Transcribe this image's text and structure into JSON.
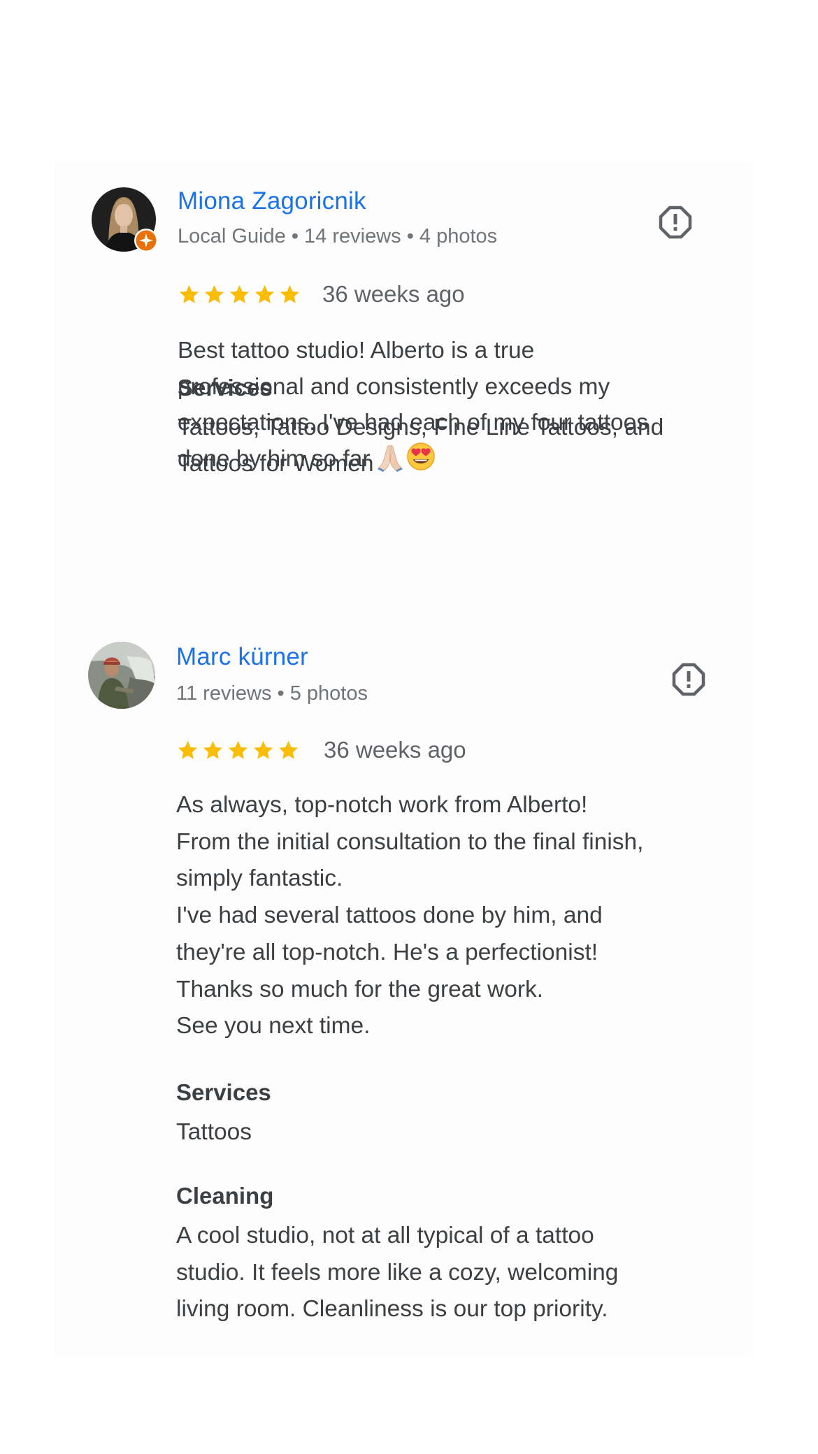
{
  "reviews": [
    {
      "author": "Miona Zagoricnik",
      "meta": "Local Guide • 14 reviews • 4 photos",
      "local_guide": true,
      "rating": 5,
      "time": "36 weeks ago",
      "text_lines": [
        "Best tattoo studio! Alberto is a true",
        "professional and consistently exceeds my",
        "expectations. I've had each of my four tattoos",
        "done by him so far"
      ],
      "text_emoji": [
        "folded-hands-emoji",
        "heart-eyes-emoji"
      ],
      "sections": [
        {
          "title": "Services",
          "lines": [
            "Tattoos, Tattoo Designs, Fine Line Tattoos, and",
            "Tattoos for Women"
          ]
        }
      ]
    },
    {
      "author": "Marc kürner",
      "meta": "11 reviews • 5 photos",
      "local_guide": false,
      "rating": 5,
      "time": "36 weeks ago",
      "text_lines": [
        "As always, top-notch work from Alberto!",
        "From the initial consultation to the final finish,",
        "simply fantastic.",
        "I've had several tattoos done by him, and",
        "they're all top-notch. He's a perfectionist!",
        "Thanks so much for the great work.",
        "See you next time."
      ],
      "sections": [
        {
          "title": "Services",
          "lines": [
            "Tattoos"
          ]
        },
        {
          "title": "Cleaning",
          "lines": [
            "A cool studio, not at all typical of a tattoo",
            "studio. It feels more like a cozy, welcoming",
            "living room. Cleanliness is our top priority."
          ]
        }
      ]
    }
  ],
  "colors": {
    "name": "#1a73e8",
    "star": "#fbbc04",
    "meta": "#70757a",
    "text": "#3c4043",
    "guide_badge": "#e8710a"
  },
  "icons": {
    "report": "report-flag-icon",
    "star": "star-icon",
    "local_guide": "local-guide-badge-icon"
  }
}
